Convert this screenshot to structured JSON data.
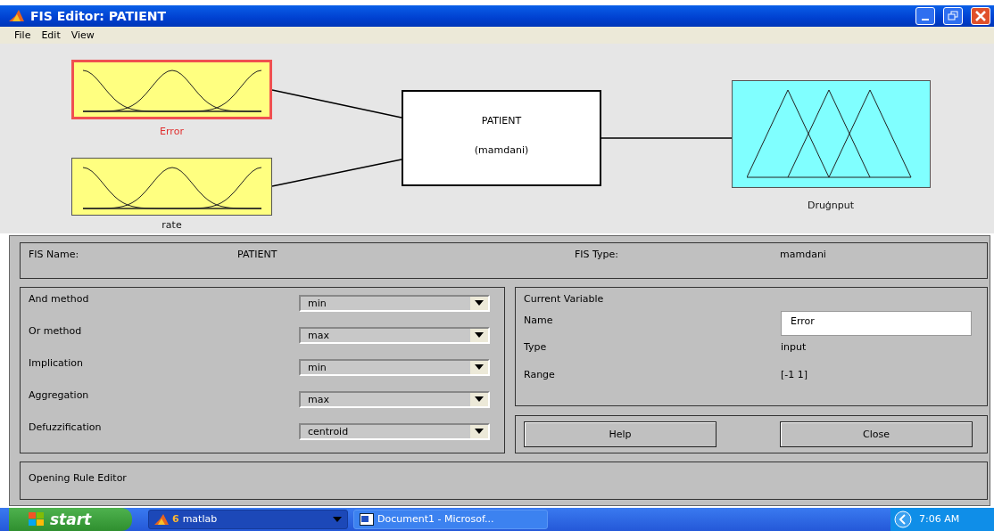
{
  "window": {
    "title": "FIS Editor: PATIENT"
  },
  "menu": [
    "File",
    "Edit",
    "View"
  ],
  "diagram": {
    "inputs": [
      {
        "label": "Error",
        "selected": true
      },
      {
        "label": "rate",
        "selected": false
      }
    ],
    "system": {
      "name": "PATIENT",
      "type": "(mamdani)"
    },
    "outputs": [
      {
        "label": "Druģnput",
        "selected": false
      }
    ]
  },
  "fis_info": {
    "name_label": "FIS Name:",
    "name": "PATIENT",
    "type_label": "FIS Type:",
    "type": "mamdani"
  },
  "methods": [
    {
      "label": "And method",
      "value": "min"
    },
    {
      "label": "Or method",
      "value": "max"
    },
    {
      "label": "Implication",
      "value": "min"
    },
    {
      "label": "Aggregation",
      "value": "max"
    },
    {
      "label": "Defuzzification",
      "value": "centroid"
    }
  ],
  "current_variable": {
    "title": "Current Variable",
    "name_label": "Name",
    "name": "Error",
    "type_label": "Type",
    "type": "input",
    "range_label": "Range",
    "range": "[-1 1]"
  },
  "buttons": [
    "Help",
    "Close"
  ],
  "status": "Opening Rule Editor",
  "taskbar": {
    "start": "start",
    "tasks": [
      {
        "count": "6",
        "label": "matlab",
        "selected": true
      },
      {
        "label": "Document1 - Microsof...",
        "selected": false
      }
    ],
    "clock": "7:06 AM"
  }
}
